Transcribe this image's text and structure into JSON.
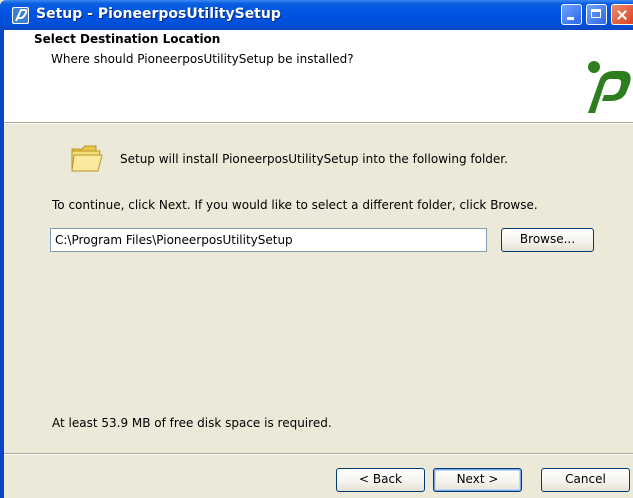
{
  "window": {
    "title": "Setup - PioneerposUtilitySetup"
  },
  "header": {
    "title": "Select Destination Location",
    "subtitle": "Where should PioneerposUtilitySetup be installed?"
  },
  "body": {
    "install_text": "Setup will install PioneerposUtilitySetup into the following folder.",
    "continue_text": "To continue, click Next. If you would like to select a different folder, click Browse.",
    "path_value": "C:\\Program Files\\PioneerposUtilitySetup",
    "browse_label": "Browse...",
    "disk_space_text": "At least 53.9 MB of free disk space is required."
  },
  "footer": {
    "back_label": "< Back",
    "next_label": "Next >",
    "cancel_label": "Cancel"
  },
  "colors": {
    "titlebar": "#0054e3",
    "dialog_bg": "#ece9d8",
    "logo_green": "#2e7d1e"
  }
}
